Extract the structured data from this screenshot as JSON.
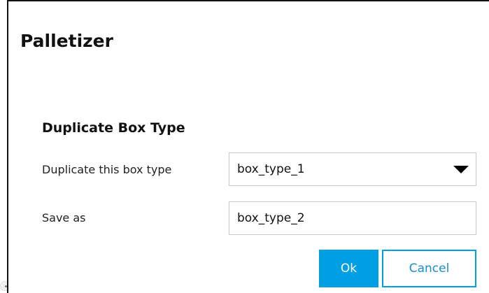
{
  "dialog": {
    "title": "Palletizer",
    "section_title": "Duplicate Box Type"
  },
  "form": {
    "duplicate_label": "Duplicate this box type",
    "duplicate_value": "box_type_1",
    "saveas_label": "Save as",
    "saveas_value": "box_type_2"
  },
  "buttons": {
    "ok_label": "Ok",
    "cancel_label": "Cancel"
  },
  "colors": {
    "accent": "#009fe3",
    "cancel_text": "#1a8fc8",
    "border": "#c8c8c8"
  },
  "icons": {
    "dropdown": "caret-down-icon",
    "edge_handle": "dot-handle-icon"
  }
}
